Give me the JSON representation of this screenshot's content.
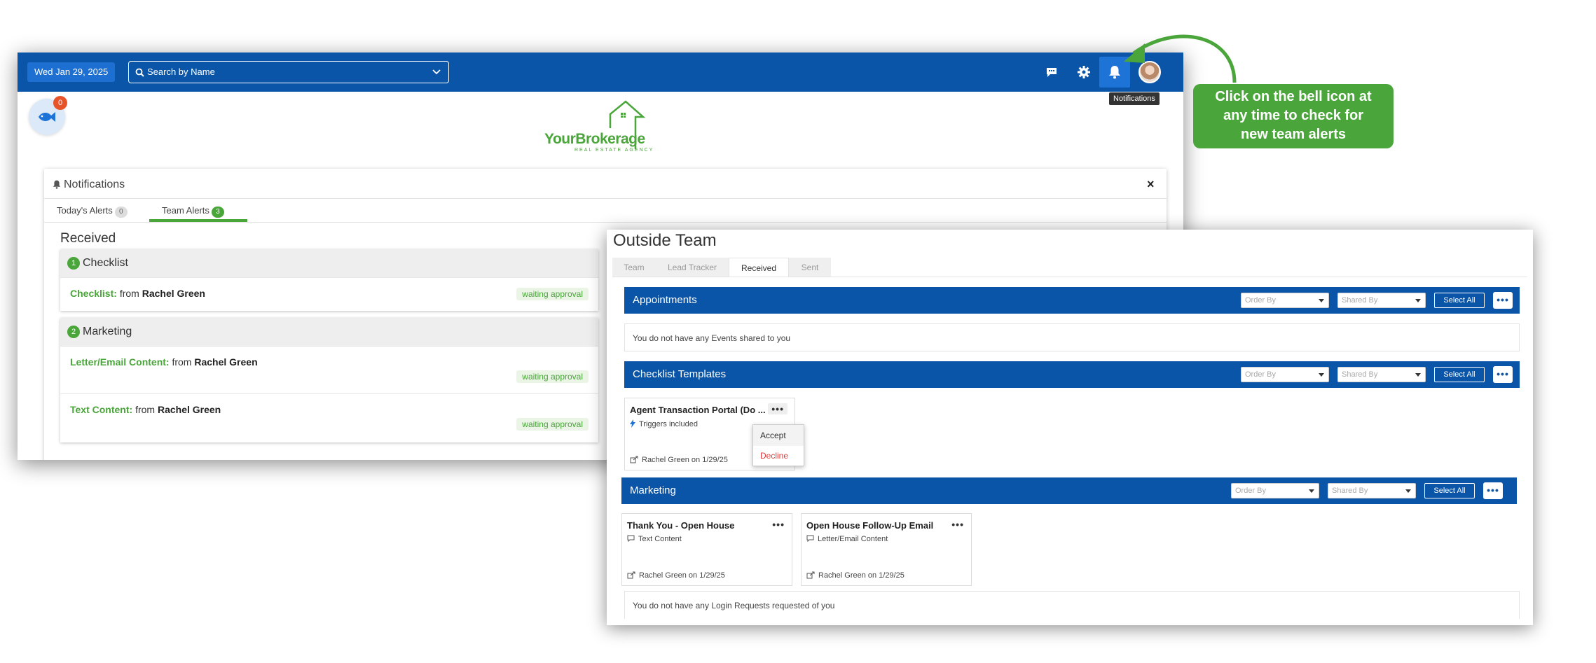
{
  "app": {
    "date": "Wed Jan 29, 2025",
    "search_placeholder": "Search by Name",
    "tooltip": "Notifications",
    "fish_badge_count": "0",
    "logo_text": "YourBrokerage",
    "logo_sub": "REAL ESTATE AGENCY"
  },
  "notifications": {
    "title": "Notifications",
    "close": "×",
    "tabs": [
      {
        "label": "Today's Alerts",
        "count": "0"
      },
      {
        "label": "Team Alerts",
        "count": "3"
      }
    ],
    "received_label": "Received",
    "groups": [
      {
        "num": "1",
        "title": "Checklist",
        "rows": [
          {
            "kind": "Checklist:",
            "from": "from",
            "who": "Rachel Green",
            "status": "waiting approval"
          }
        ]
      },
      {
        "num": "2",
        "title": "Marketing",
        "rows": [
          {
            "kind": "Letter/Email Content:",
            "from": "from",
            "who": "Rachel Green",
            "status": "waiting approval"
          },
          {
            "kind": "Text Content:",
            "from": "from",
            "who": "Rachel Green",
            "status": "waiting approval"
          }
        ]
      }
    ]
  },
  "outside_team": {
    "title": "Outside Team",
    "tabs": [
      "Team",
      "Lead Tracker",
      "Received",
      "Sent"
    ],
    "active_tab": "Received",
    "order_by": "Order By",
    "shared_by": "Shared By",
    "select_all": "Select All",
    "more": "•••",
    "sections": {
      "appointments": {
        "title": "Appointments",
        "empty": "You do not have any Events shared to you"
      },
      "checklist": {
        "title": "Checklist Templates",
        "card": {
          "title": "Agent Transaction Portal (Do ...",
          "sub": "Triggers included",
          "foot": "Rachel Green on 1/29/25"
        },
        "menu": {
          "accept": "Accept",
          "decline": "Decline"
        }
      },
      "marketing": {
        "title": "Marketing",
        "cards": [
          {
            "title": "Thank You - Open House",
            "sub": "Text Content",
            "foot": "Rachel Green on 1/29/25"
          },
          {
            "title": "Open House Follow-Up Email",
            "sub": "Letter/Email Content",
            "foot": "Rachel Green on 1/29/25"
          }
        ],
        "empty": "You do not have any Login Requests requested of you"
      }
    }
  },
  "callout": {
    "lines": [
      "Click on the bell icon at",
      "any time to check for",
      "new team alerts"
    ],
    "color": "#4aa53a"
  },
  "colors": {
    "brand_blue": "#0a55a8",
    "accent_green": "#4aa53a",
    "decline_red": "#e03a3a"
  }
}
